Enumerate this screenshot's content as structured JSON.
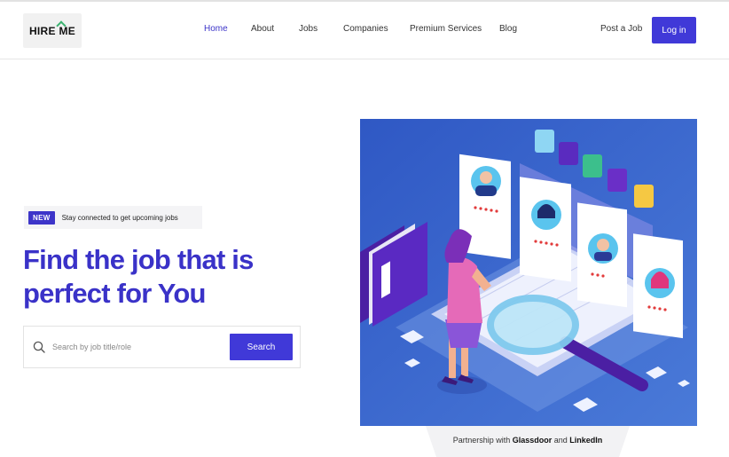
{
  "logo": {
    "text_a": "HIRE ",
    "text_b": "ME"
  },
  "nav": {
    "items": [
      {
        "label": "Home",
        "active": true
      },
      {
        "label": "About"
      },
      {
        "label": "Jobs"
      },
      {
        "label": "Companies"
      },
      {
        "label": "Premium Services"
      },
      {
        "label": "Blog"
      }
    ],
    "post_job": "Post a Job",
    "login": "Log in"
  },
  "hero": {
    "badge": "NEW",
    "badge_text": "Stay connected to get upcoming jobs",
    "headline": "Find the job that is perfect for You",
    "search": {
      "placeholder": "Search by job title/role",
      "value": "",
      "button": "Search"
    }
  },
  "partnership": {
    "prefix": "Partnership with ",
    "partner1": "Glassdoor",
    "joiner": " and ",
    "partner2": "LinkedIn"
  },
  "colors": {
    "accent": "#4039d8",
    "headline": "#3a32c8",
    "illustration_bg": "#3b67c9"
  },
  "icons": [
    "search-icon",
    "logo-check-icon"
  ]
}
